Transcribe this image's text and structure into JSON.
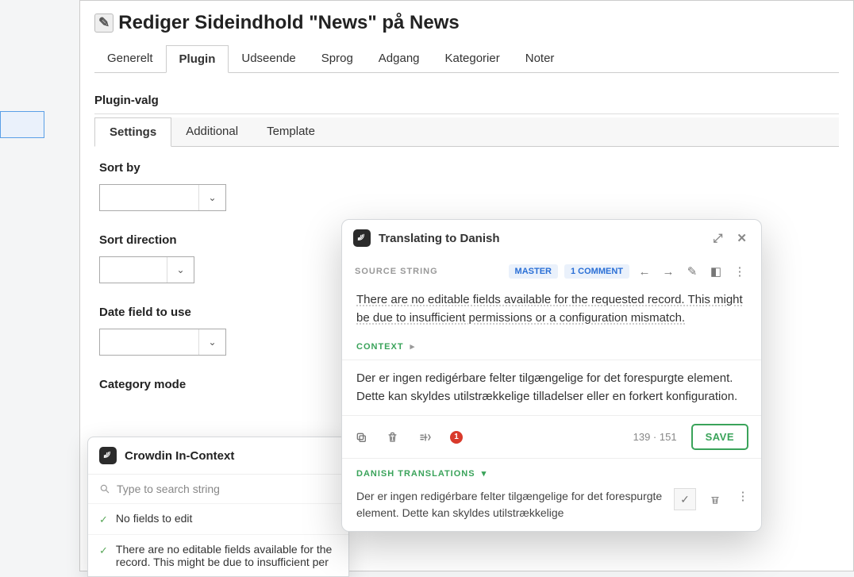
{
  "page": {
    "title": "Rediger Sideindhold \"News\" på News"
  },
  "tabs": {
    "items": [
      "Generelt",
      "Plugin",
      "Udseende",
      "Sprog",
      "Adgang",
      "Kategorier",
      "Noter"
    ],
    "active": 1
  },
  "plugin": {
    "section_title": "Plugin-valg",
    "subtabs": [
      "Settings",
      "Additional",
      "Template"
    ],
    "subtab_active": 0,
    "fields": {
      "sort_by": "Sort by",
      "sort_direction": "Sort direction",
      "date_field": "Date field to use",
      "category_mode": "Category mode"
    }
  },
  "incontext": {
    "title": "Crowdin In-Context",
    "search_placeholder": "Type to search string",
    "items": [
      "No fields to edit",
      "There are no editable fields available for the record. This might be due to insufficient per"
    ]
  },
  "modal": {
    "title": "Translating to Danish",
    "source_label": "SOURCE STRING",
    "badges": {
      "master": "MASTER",
      "comments": "1 COMMENT"
    },
    "source_text": "There are no editable fields available for the requested record. This might be due to insufficient permissions or a configuration mismatch.",
    "context_label": "CONTEXT",
    "translation": "Der er ingen redigérbare felter tilgængelige for det forespurgte element. Dette kan skyldes utilstrækkelige tilladelser eller en forkert konfiguration.",
    "issues_count": "1",
    "counter": "139  ·  151",
    "save": "SAVE",
    "danish_label": "DANISH TRANSLATIONS",
    "danish_item": "Der er ingen redigérbare felter tilgængelige for det forespurgte element. Dette kan skyldes utilstrækkelige"
  }
}
